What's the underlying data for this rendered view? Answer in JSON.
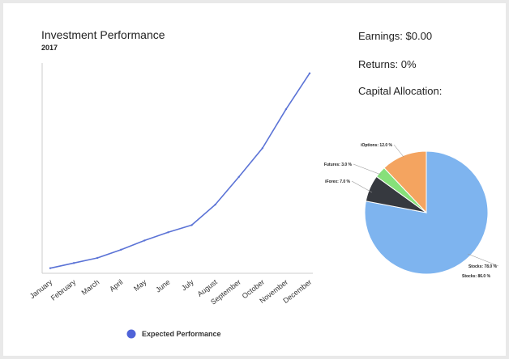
{
  "header": {
    "title": "Investment Performance",
    "subtitle": "2017"
  },
  "stats": {
    "earnings": "Earnings: $0.00",
    "returns": "Returns: 0%",
    "allocation_label": "Capital Allocation:"
  },
  "colors": {
    "line": "#5b73d6",
    "axis": "#cccccc",
    "legend_dot": "#4f63d8"
  },
  "chart_data": [
    {
      "type": "line",
      "title": "Investment Performance",
      "subtitle": "2017",
      "categories": [
        "January",
        "February",
        "March",
        "April",
        "May",
        "June",
        "July",
        "August",
        "September",
        "October",
        "November",
        "December"
      ],
      "series": [
        {
          "name": "Expected Performance",
          "values": [
            5,
            10,
            15,
            23,
            32,
            40,
            47,
            67,
            94,
            122,
            160,
            195
          ]
        }
      ],
      "ylim": [
        0,
        205
      ],
      "grid": false,
      "legend": "bottom"
    },
    {
      "type": "pie",
      "title": "Capital Allocation:",
      "slices": [
        {
          "label": "Stocks: 78.0 %",
          "value": 78.0,
          "color": "#7eb4ef"
        },
        {
          "label": "iForex: 7.0 %",
          "value": 7.0,
          "color": "#36393f"
        },
        {
          "label": "Futures: 3.0 %",
          "value": 3.0,
          "color": "#86e07a"
        },
        {
          "label": "iOptions: 12.0 %",
          "value": 12.0,
          "color": "#f4a460"
        }
      ],
      "extra_labels": [
        "Stocks: 86.0 %"
      ]
    }
  ]
}
